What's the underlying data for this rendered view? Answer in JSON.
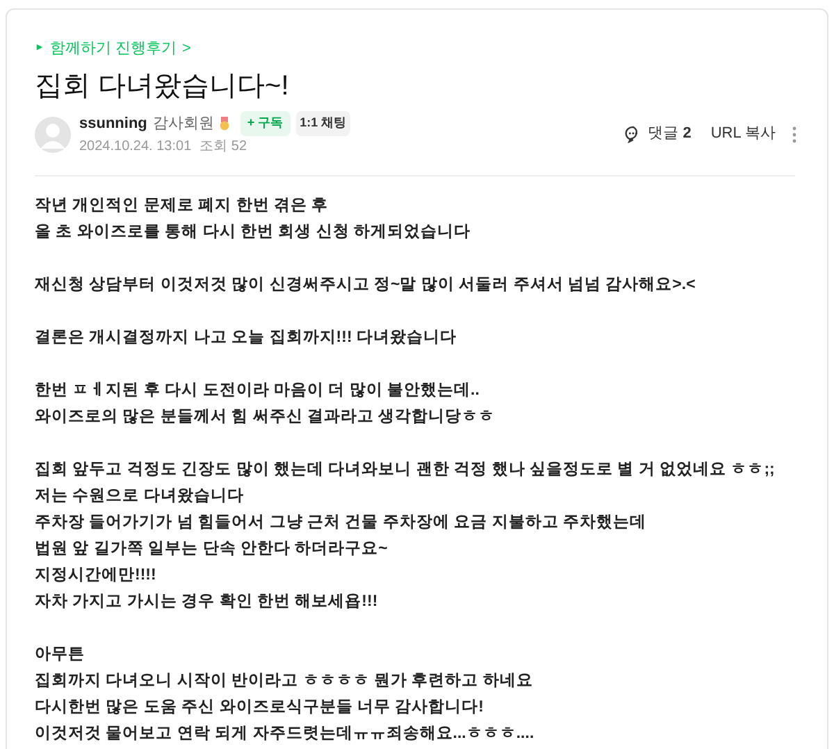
{
  "breadcrumb": {
    "marker": "►",
    "label": "함께하기 진행후기",
    "chevron": ">"
  },
  "title": "집회 다녀왔습니다~!",
  "author": {
    "name": "ssunning",
    "grade": "감사회원",
    "subscribe": "+ 구독",
    "chat": "1:1 채팅",
    "date": "2024.10.24. 13:01",
    "views": "조회 52"
  },
  "actions": {
    "comment_label": "댓글",
    "comment_count": "2",
    "url_copy": "URL 복사"
  },
  "body": [
    [
      "작년 개인적인 문제로 폐지 한번 겪은 후",
      "올 초 와이즈로를 통해 다시 한번 회생 신청 하게되었습니다"
    ],
    [
      "재신청 상담부터 이것저것 많이 신경써주시고 정~말 많이 서둘러 주셔서 넘넘 감사해요>.<"
    ],
    [
      "결론은 개시결정까지 나고 오늘 집회까지!!! 다녀왔습니다"
    ],
    [
      "한번 ㅍㅔ지된 후 다시 도전이라 마음이 더 많이 불안했는데..",
      "와이즈로의 많은 분들께서 힘 써주신 결과라고 생각합니당ㅎㅎ"
    ],
    [
      "집회 앞두고 걱정도 긴장도 많이 했는데 다녀와보니 괜한 걱정 했나 싶을정도로 별 거 없었네요 ㅎㅎ;;",
      "저는 수원으로 다녀왔습니다",
      "주차장 들어가기가 넘 힘들어서 그냥 근처 건물 주차장에 요금 지불하고 주차했는데",
      "법원 앞 길가쪽 일부는 단속 안한다 하더라구요~",
      "지정시간에만!!!!",
      "자차 가지고 가시는 경우 확인 한번 해보세욥!!!"
    ],
    [
      "아무튼",
      "집회까지 다녀오니 시작이 반이라고 ㅎㅎㅎㅎ 뭔가 후련하고 하네요",
      "다시한번 많은 도움 주신 와이즈로식구분들 너무 감사합니다!",
      "이것저것 물어보고 연락 되게 자주드렷는데ㅠㅠ죄송해요...ㅎㅎㅎ...."
    ]
  ]
}
